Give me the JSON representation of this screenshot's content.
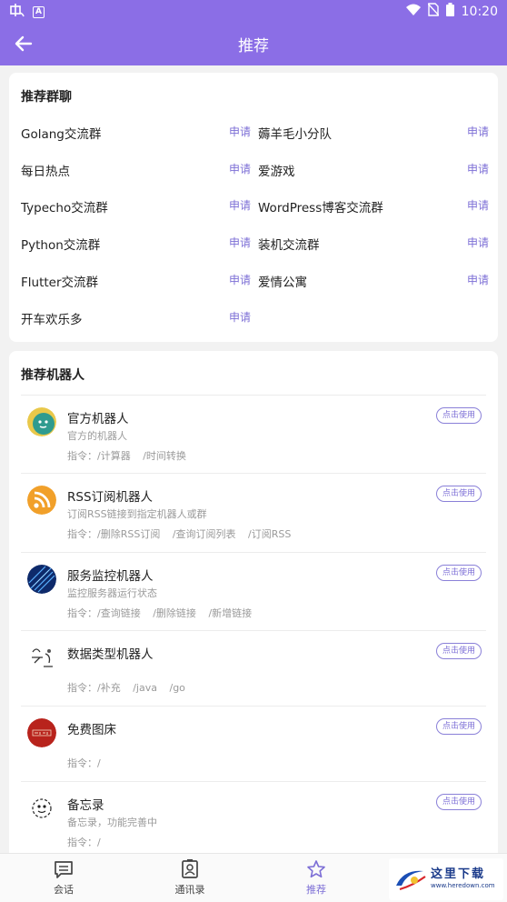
{
  "status_bar": {
    "time": "10:20",
    "a_badge": "A"
  },
  "header": {
    "title": "推荐"
  },
  "groups_section": {
    "title": "推荐群聊",
    "apply_label": "申请",
    "groups": [
      {
        "name": "Golang交流群"
      },
      {
        "name": "薅羊毛小分队"
      },
      {
        "name": "每日热点"
      },
      {
        "name": "爱游戏"
      },
      {
        "name": "Typecho交流群"
      },
      {
        "name": "WordPress博客交流群"
      },
      {
        "name": "Python交流群"
      },
      {
        "name": "装机交流群"
      },
      {
        "name": "Flutter交流群"
      },
      {
        "name": "爱情公寓"
      },
      {
        "name": "开车欢乐多"
      }
    ]
  },
  "bots_section": {
    "title": "推荐机器人",
    "use_label": "点击使用",
    "bots": [
      {
        "name": "官方机器人",
        "desc": "官方的机器人",
        "commands": [
          "指令：/计算器",
          "/时间转换"
        ]
      },
      {
        "name": "RSS订阅机器人",
        "desc": "订阅RSS链接到指定机器人或群",
        "commands": [
          "指令：/删除RSS订阅",
          "/查询订阅列表",
          "/订阅RSS"
        ]
      },
      {
        "name": "服务监控机器人",
        "desc": "监控服务器运行状态",
        "commands": [
          "指令：/查询链接",
          "/删除链接",
          "/新增链接"
        ]
      },
      {
        "name": "数据类型机器人",
        "desc": "",
        "commands": [
          "指令：/补充",
          "/java",
          "/go"
        ]
      },
      {
        "name": "免费图床",
        "desc": "",
        "commands": [
          "指令：/"
        ]
      },
      {
        "name": "备忘录",
        "desc": "备忘录，功能完善中",
        "commands": [
          "指令：/"
        ]
      }
    ]
  },
  "bottom_nav": {
    "items": [
      {
        "label": "会话",
        "icon": "chat-icon"
      },
      {
        "label": "通讯录",
        "icon": "contacts-icon"
      },
      {
        "label": "推荐",
        "icon": "star-icon"
      }
    ]
  },
  "watermark": {
    "text": "这里下载",
    "url": "www.heredown.com"
  },
  "colors": {
    "primary": "#8b6ee6",
    "accent_text": "#7d6fd6"
  }
}
